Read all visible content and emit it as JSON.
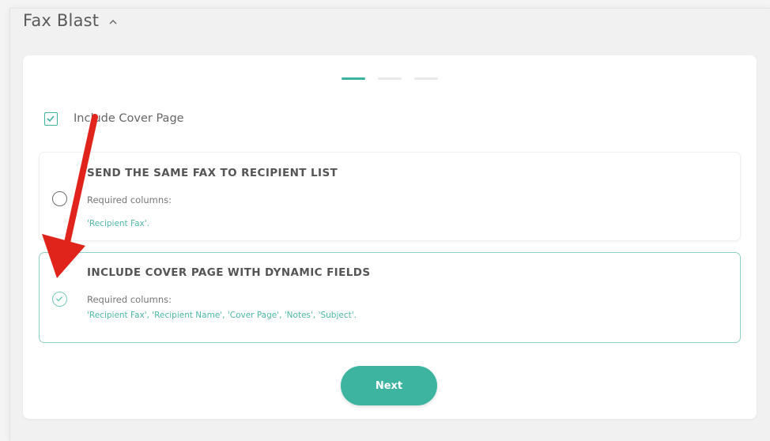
{
  "header": {
    "title": "Fax Blast",
    "toggle_icon": "chevron-up-icon"
  },
  "stepper": {
    "steps": 3,
    "current_step": 1
  },
  "cover_page": {
    "label": "Include Cover Page",
    "checked": true
  },
  "options": [
    {
      "title": "SEND THE SAME FAX TO RECIPIENT LIST",
      "required_label": "Required columns:",
      "columns": "'Recipient Fax'.",
      "selected": false
    },
    {
      "title": "INCLUDE COVER PAGE WITH DYNAMIC FIELDS",
      "required_label": "Required columns:",
      "columns": "'Recipient Fax', 'Recipient Name', 'Cover Page', 'Notes', 'Subject'.",
      "selected": true
    }
  ],
  "next_button": {
    "label": "Next"
  },
  "annotation": {
    "icon": "red-arrow-icon",
    "color": "#e0241b"
  },
  "colors": {
    "accent": "#3cb4a0"
  }
}
